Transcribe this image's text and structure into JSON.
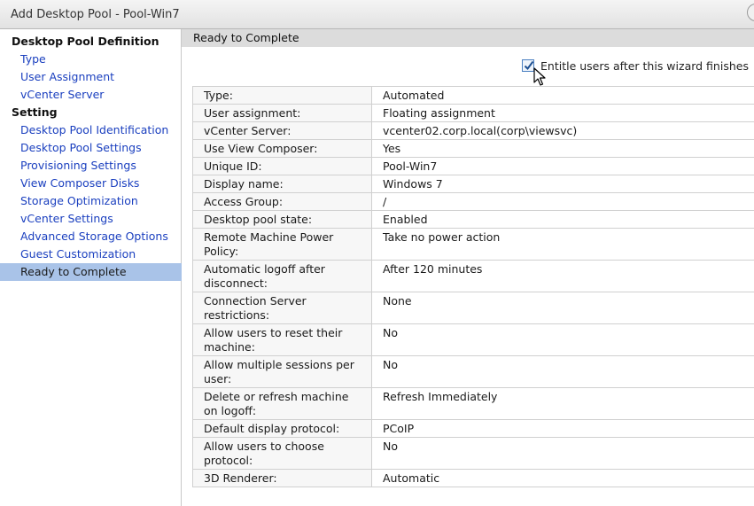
{
  "window": {
    "title": "Add Desktop Pool - Pool-Win7"
  },
  "sidebar": {
    "items": [
      {
        "label": "Desktop Pool Definition",
        "kind": "heading"
      },
      {
        "label": "Type",
        "kind": "link"
      },
      {
        "label": "User Assignment",
        "kind": "link"
      },
      {
        "label": "vCenter Server",
        "kind": "link"
      },
      {
        "label": "Setting",
        "kind": "heading"
      },
      {
        "label": "Desktop Pool Identification",
        "kind": "link"
      },
      {
        "label": "Desktop Pool Settings",
        "kind": "link"
      },
      {
        "label": "Provisioning Settings",
        "kind": "link"
      },
      {
        "label": "View Composer Disks",
        "kind": "link"
      },
      {
        "label": "Storage Optimization",
        "kind": "link"
      },
      {
        "label": "vCenter Settings",
        "kind": "link"
      },
      {
        "label": "Advanced Storage Options",
        "kind": "link"
      },
      {
        "label": "Guest Customization",
        "kind": "link"
      },
      {
        "label": "Ready to Complete",
        "kind": "link",
        "active": true
      }
    ]
  },
  "main": {
    "header": "Ready to Complete",
    "entitle": {
      "label": "Entitle users after this wizard finishes",
      "checked": true
    },
    "summary": [
      {
        "key": "Type:",
        "value": "Automated"
      },
      {
        "key": "User assignment:",
        "value": "Floating assignment"
      },
      {
        "key": "vCenter Server:",
        "value": "vcenter02.corp.local(corp\\viewsvc)"
      },
      {
        "key": "Use View Composer:",
        "value": "Yes"
      },
      {
        "key": "Unique ID:",
        "value": "Pool-Win7"
      },
      {
        "key": "Display name:",
        "value": "Windows 7"
      },
      {
        "key": "Access Group:",
        "value": "/"
      },
      {
        "key": "Desktop pool state:",
        "value": "Enabled"
      },
      {
        "key": "Remote Machine Power Policy:",
        "value": "Take no power action"
      },
      {
        "key": "Automatic logoff after disconnect:",
        "value": "After 120 minutes"
      },
      {
        "key": "Connection Server restrictions:",
        "value": "None"
      },
      {
        "key": "Allow users to reset their machine:",
        "value": "No"
      },
      {
        "key": "Allow multiple sessions per user:",
        "value": "No"
      },
      {
        "key": "Delete or refresh machine on logoff:",
        "value": "Refresh Immediately"
      },
      {
        "key": "Default display protocol:",
        "value": "PCoIP"
      },
      {
        "key": "Allow users to choose protocol:",
        "value": "No"
      },
      {
        "key": "3D Renderer:",
        "value": "Automatic"
      }
    ]
  },
  "colors": {
    "link": "#1a3fbf",
    "active_bg": "#a9c3e8",
    "header_bg": "#dcdcdc"
  }
}
